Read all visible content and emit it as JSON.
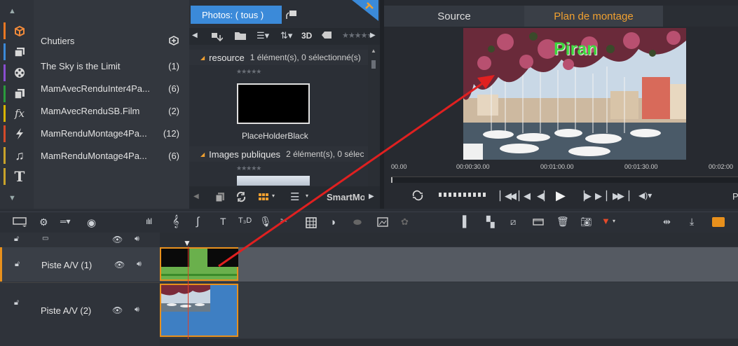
{
  "categories": [
    {
      "icon": "project-bin-icon",
      "color": "#e87722"
    },
    {
      "icon": "collections-icon",
      "color": "#3b8ad9"
    },
    {
      "icon": "film-reel-icon",
      "color": "#8a4dd0"
    },
    {
      "icon": "stacked-pages-icon",
      "color": "#2a9b3c"
    },
    {
      "icon": "fx-icon",
      "color": "#d8b400"
    },
    {
      "icon": "transition-bolt-icon",
      "color": "#d44a2a"
    },
    {
      "icon": "music-note-icon",
      "color": "#c9a32a"
    },
    {
      "icon": "title-t-icon",
      "color": "#c9a32a"
    }
  ],
  "bins": {
    "header": "Chutiers",
    "items": [
      {
        "name": "The Sky is the Limit",
        "count": "(1)"
      },
      {
        "name": "MamAvecRenduInter4Pa...",
        "count": "(6)"
      },
      {
        "name": "MamAvecRenduSB.Film",
        "count": "(2)"
      },
      {
        "name": "MamRenduMontage4Pa...",
        "count": "(12)"
      },
      {
        "name": "MamRenduMontage4Pa...",
        "count": "(6)"
      }
    ]
  },
  "library": {
    "tab_label": "Photos: ( tous )",
    "toolbar_3d": "3D",
    "groups": [
      {
        "name": "resource",
        "info": "1 élément(s), 0 sélectionné(s)",
        "item": "PlaceHolderBlack"
      },
      {
        "name": "Images publiques",
        "info": "2 élément(s), 0 sélec"
      }
    ],
    "smartmovie": "SmartMo"
  },
  "preview": {
    "tabs": [
      "Source",
      "Plan de montage"
    ],
    "active_tab": 1,
    "overlay_title": "Piran",
    "ruler": [
      "00.00",
      "00:00:30.00",
      "00:01:00.00",
      "00:01:30.00",
      "00:02:00"
    ],
    "right_label": "P"
  },
  "timeline": {
    "tracks": [
      {
        "name": "Piste A/V (1)"
      },
      {
        "name": "Piste A/V (2)"
      }
    ]
  },
  "colors": {
    "accent": "#3b8ad9",
    "active_tab_text": "#f0a030",
    "arrow": "#e02020",
    "clip_selected_border": "#e8901c"
  }
}
